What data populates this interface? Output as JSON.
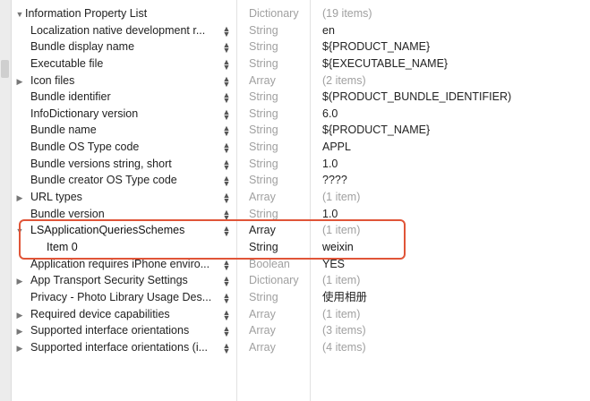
{
  "root": {
    "key": "Information Property List",
    "type": "Dictionary",
    "value": "(19 items)"
  },
  "rows": [
    {
      "key": "Localization native development r...",
      "type": "String",
      "value": "en"
    },
    {
      "key": "Bundle display name",
      "type": "String",
      "value": "${PRODUCT_NAME}"
    },
    {
      "key": "Executable file",
      "type": "String",
      "value": "${EXECUTABLE_NAME}"
    },
    {
      "key": "Icon files",
      "type": "Array",
      "value": "(2 items)"
    },
    {
      "key": "Bundle identifier",
      "type": "String",
      "value": "$(PRODUCT_BUNDLE_IDENTIFIER)"
    },
    {
      "key": "InfoDictionary version",
      "type": "String",
      "value": "6.0"
    },
    {
      "key": "Bundle name",
      "type": "String",
      "value": "${PRODUCT_NAME}"
    },
    {
      "key": "Bundle OS Type code",
      "type": "String",
      "value": "APPL"
    },
    {
      "key": "Bundle versions string, short",
      "type": "String",
      "value": "1.0"
    },
    {
      "key": "Bundle creator OS Type code",
      "type": "String",
      "value": "????"
    },
    {
      "key": "URL types",
      "type": "Array",
      "value": "(1 item)"
    },
    {
      "key": "Bundle version",
      "type": "String",
      "value": "1.0"
    },
    {
      "key": "LSApplicationQueriesSchemes",
      "type": "Array",
      "value": "(1 item)"
    },
    {
      "key": "Item 0",
      "type": "String",
      "value": "weixin"
    },
    {
      "key": "Application requires iPhone enviro...",
      "type": "Boolean",
      "value": "YES"
    },
    {
      "key": "App Transport Security Settings",
      "type": "Dictionary",
      "value": "(1 item)"
    },
    {
      "key": "Privacy - Photo Library Usage Des...",
      "type": "String",
      "value": "使用相册"
    },
    {
      "key": "Required device capabilities",
      "type": "Array",
      "value": "(1 item)"
    },
    {
      "key": "Supported interface orientations",
      "type": "Array",
      "value": "(3 items)"
    },
    {
      "key": "Supported interface orientations (i...",
      "type": "Array",
      "value": "(4 items)"
    }
  ],
  "icons": {
    "expanded": "disclosure-down-icon",
    "collapsed": "disclosure-right-icon",
    "stepper": "up-down-stepper-icon"
  },
  "colors": {
    "highlight_border": "#e05538",
    "type_text": "#a0a0a0"
  }
}
